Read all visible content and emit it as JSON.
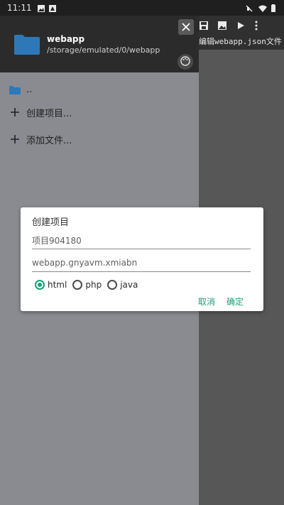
{
  "status_bar": {
    "time": "11:11",
    "left_icons": [
      "image-icon",
      "notification-icon"
    ],
    "right_icons": [
      "mute-icon",
      "wifi-icon",
      "battery-icon"
    ]
  },
  "toolbar": {
    "icons": [
      "save-icon",
      "image-icon",
      "play-icon",
      "more-icon"
    ],
    "hint": "编辑webapp.json文件"
  },
  "drawer": {
    "title": "webapp",
    "path": "/storage/emulated/0/webapp",
    "items": [
      {
        "label": "..",
        "icon": "folder-icon"
      },
      {
        "label": "创建项目...",
        "icon": "plus-icon"
      },
      {
        "label": "添加文件...",
        "icon": "plus-icon"
      }
    ]
  },
  "dialog": {
    "title": "创建项目",
    "name_input": "项目904180",
    "package_input": "webapp.gnyavm.xmiabn",
    "radios": [
      {
        "label": "html",
        "checked": true
      },
      {
        "label": "php",
        "checked": false
      },
      {
        "label": "java",
        "checked": false
      }
    ],
    "cancel_label": "取消",
    "confirm_label": "确定"
  },
  "colors": {
    "accent": "#1a9f7a",
    "drawer_header": "#2b2b2b",
    "drawer_bg": "#8a8b90",
    "folder": "#2f78b7"
  }
}
